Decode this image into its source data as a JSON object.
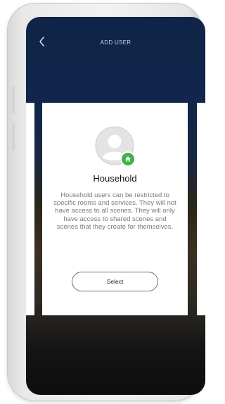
{
  "header": {
    "title": "ADD USER",
    "back_icon": "chevron-left-icon"
  },
  "card": {
    "role_title": "Household",
    "description": "Household users can be restricted to specific rooms and services. They will not have access to all scenes. They will only have access to shared scenes and scenes that they create for themselves.",
    "select_label": "Select",
    "avatar_icon": "user-avatar-icon",
    "badge_icon": "home-icon",
    "badge_color": "#3fb24a"
  },
  "colors": {
    "header_bg": "#0f2447",
    "card_bg": "#ffffff"
  }
}
